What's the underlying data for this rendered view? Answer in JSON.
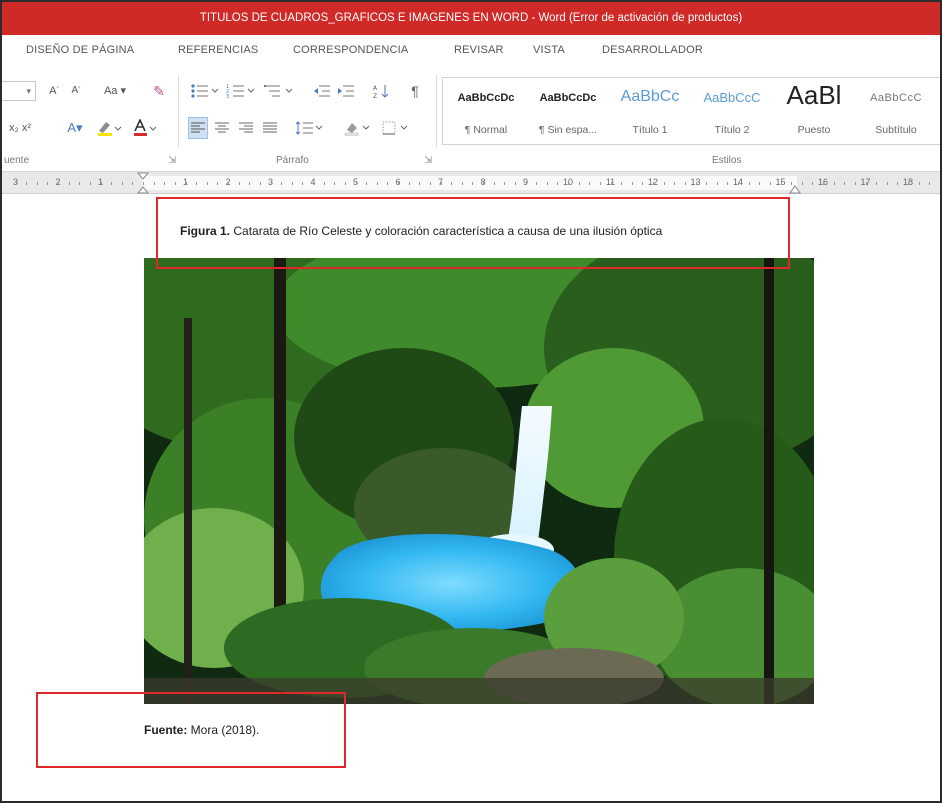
{
  "window": {
    "title": "TITULOS DE CUADROS_GRAFICOS E IMAGENES EN WORD - Word (Error de activación de productos)"
  },
  "ribbon_tabs": [
    {
      "label": "DISEÑO DE PÁGINA"
    },
    {
      "label": "REFERENCIAS"
    },
    {
      "label": "CORRESPONDENCIA"
    },
    {
      "label": "REVISAR"
    },
    {
      "label": "VISTA"
    },
    {
      "label": "DESARROLLADOR"
    }
  ],
  "groups": {
    "font_label": "uente",
    "paragraph_label": "Párrafo",
    "styles_label": "Estilos"
  },
  "styles": [
    {
      "preview": "AaBbCcDc",
      "name": "¶ Normal"
    },
    {
      "preview": "AaBbCcDc",
      "name": "¶ Sin espa..."
    },
    {
      "preview": "AaBbCc",
      "name": "Título 1"
    },
    {
      "preview": "AaBbCcC",
      "name": "Título 2"
    },
    {
      "preview": "AaBl",
      "name": "Puesto"
    },
    {
      "preview": "AaBbCcC",
      "name": "Subtítulo"
    }
  ],
  "ruler": {
    "numbers": [
      "3",
      "2",
      "1",
      "1",
      "2",
      "3",
      "4",
      "5",
      "6",
      "7",
      "8",
      "9",
      "10",
      "11",
      "12",
      "13",
      "14",
      "15",
      "16",
      "17",
      "18"
    ]
  },
  "document": {
    "caption_bold": "Figura 1.",
    "caption_text": " Catarata de Río Celeste y coloración característica a causa de una ilusión óptica",
    "source_bold": "Fuente:",
    "source_text": " Mora (2018)."
  },
  "colors": {
    "title_bar": "#cf2a27",
    "highlight": "#e0282a",
    "heading_blue": "#5b9bd5"
  }
}
